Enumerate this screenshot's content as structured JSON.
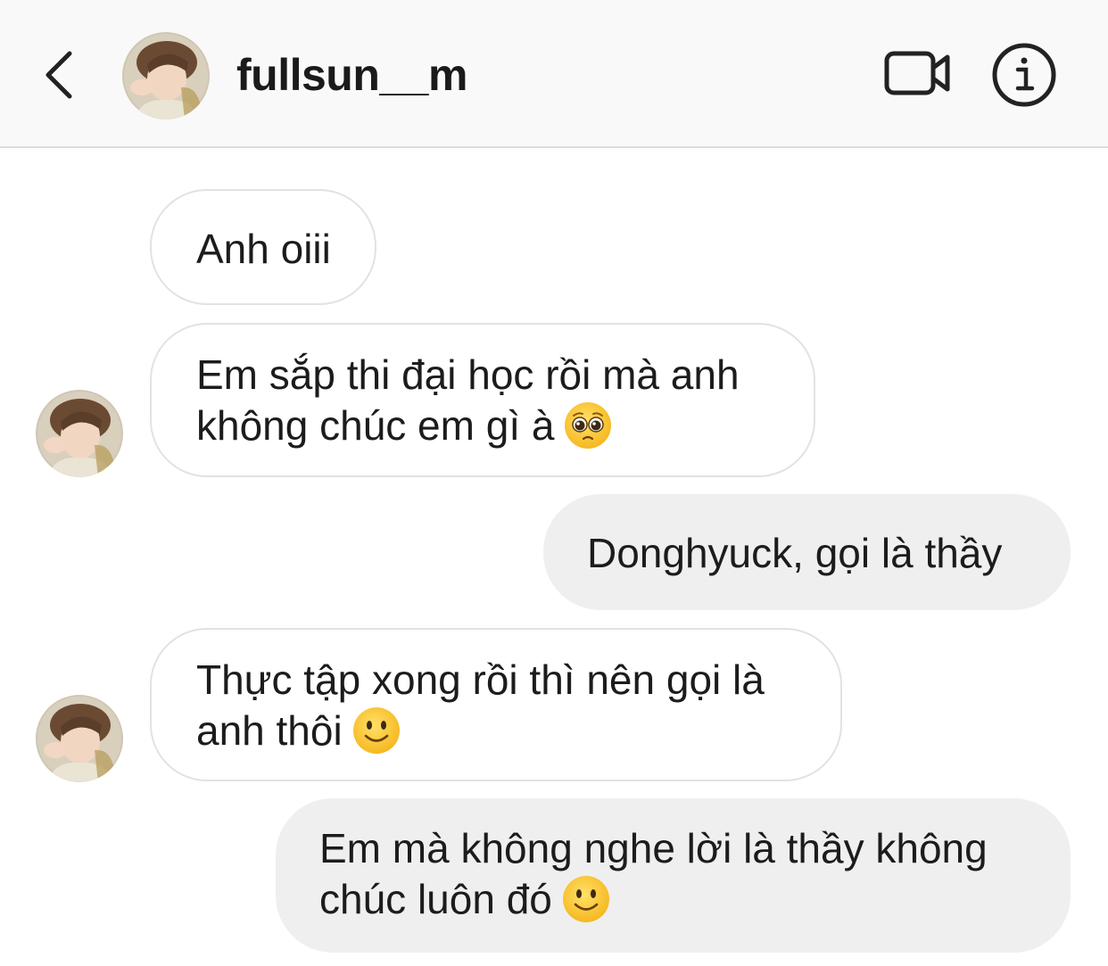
{
  "header": {
    "username": "fullsun__m",
    "back_icon": "chevron-left-icon",
    "video_icon": "video-camera-icon",
    "info_icon": "info-icon"
  },
  "messages": [
    {
      "side": "incoming",
      "text": "Anh oiii",
      "emoji": null
    },
    {
      "side": "incoming",
      "line1": "Em sắp thi đại học rồi mà anh",
      "line2": "không chúc em gì à",
      "emoji": "pleading-face-emoji"
    },
    {
      "side": "outgoing",
      "text": "Donghyuck, gọi là thầy",
      "emoji": null
    },
    {
      "side": "incoming",
      "line1": "Thực tập xong rồi thì nên gọi là",
      "line2": "anh thôi",
      "emoji": "slightly-smiling-face-emoji"
    },
    {
      "side": "outgoing",
      "line1": "Em mà không nghe lời là thầy không",
      "line2": "chúc luôn đó",
      "emoji": "slightly-smiling-face-emoji"
    }
  ],
  "colors": {
    "header_bg": "#f9f9f9",
    "incoming_border": "#e2e2e2",
    "outgoing_bg": "#efefef",
    "text": "#1c1c1c"
  }
}
